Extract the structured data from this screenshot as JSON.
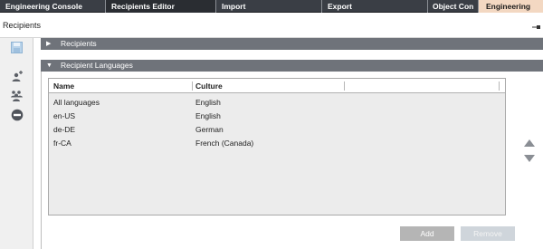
{
  "tabs": [
    {
      "label": "Engineering Console"
    },
    {
      "label": "Recipients Editor"
    },
    {
      "label": "Import"
    },
    {
      "label": "Export"
    },
    {
      "label": "Object Con"
    },
    {
      "label": "Engineering"
    }
  ],
  "title": "Recipients",
  "toolbar": {
    "icons": [
      "save-icon",
      "add-user-icon",
      "user-group-icon",
      "remove-icon"
    ]
  },
  "sections": {
    "recipients": {
      "label": "Recipients",
      "state": "collapsed"
    },
    "languages": {
      "label": "Recipient Languages",
      "state": "expanded"
    }
  },
  "languages_table": {
    "columns": [
      "Name",
      "Culture"
    ],
    "rows": [
      {
        "name": "All languages",
        "culture": "English"
      },
      {
        "name": "en-US",
        "culture": "English"
      },
      {
        "name": "de-DE",
        "culture": "German"
      },
      {
        "name": "fr-CA",
        "culture": "French (Canada)"
      }
    ]
  },
  "buttons": {
    "add": "Add",
    "remove": "Remove"
  },
  "colors": {
    "tab_bar": "#3a3e45",
    "active_tab": "#2a2d32",
    "engineering_tab": "#f3d8c2",
    "section_header": "#6f737a",
    "grid_bg": "#ececec"
  }
}
